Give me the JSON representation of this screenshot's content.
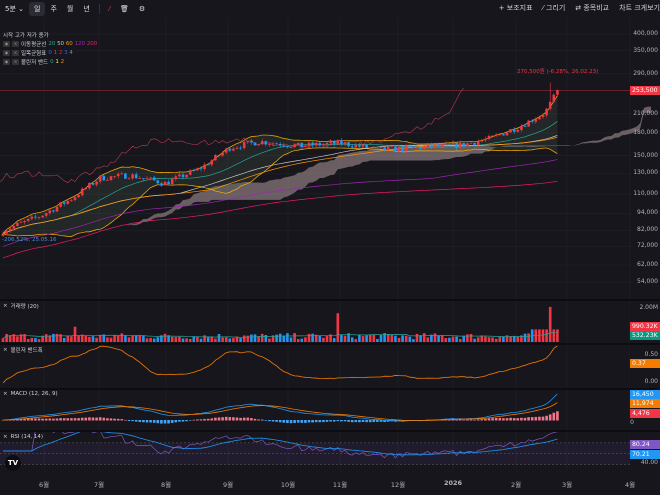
{
  "toolbar": {
    "interval": "5분",
    "periods": [
      "일",
      "주",
      "월",
      "년"
    ],
    "active_period": "일",
    "right": [
      "+ 보조지표",
      "⁄ 그리기",
      "⇄ 종목비교",
      "차트 크게보기"
    ]
  },
  "legend": {
    "ohlc_label": "시작 고가 저가 종가",
    "ma": {
      "name": "이동평균선",
      "periods": [
        "20",
        "50",
        "60",
        "120",
        "200"
      ],
      "colors": [
        "#26a69a",
        "#c8c8c8",
        "#ff9800",
        "#9c27b0",
        "#e91e63"
      ]
    },
    "ichimoku": {
      "name": "일목균형표",
      "params": [
        "0",
        "1",
        "2",
        "3",
        "4"
      ],
      "colors": [
        "#2962ff",
        "#f23645",
        "#e91e63",
        "#2962ff",
        "#888888"
      ]
    },
    "bollinger": {
      "name": "볼린저 밴드",
      "params": [
        "0",
        "1",
        "2"
      ],
      "colors": [
        "#26a69a",
        "#ffeb3b",
        "#ff9800"
      ]
    }
  },
  "price_axis": [
    "400,000",
    "350,000",
    "290,000",
    "210,000",
    "180,000",
    "150,000",
    "130,000",
    "110,000",
    "94,000",
    "82,000",
    "72,000",
    "62,000",
    "54,000"
  ],
  "last_price": "253,500",
  "annotations": {
    "high": "270,500원 (-6.28%, 26.02.23)",
    "low": "-206.52%, 25.05.16"
  },
  "panels": {
    "volume": {
      "title": "거래량 (20)",
      "axis": "2.00M",
      "value": "990.32K",
      "ma_value": "532.23K"
    },
    "bbw": {
      "title": "볼린저 밴드폭",
      "axis_top": "0.50",
      "axis_bottom": "0.00",
      "value": "0.37"
    },
    "macd": {
      "title": "MACD (12, 26, 9)",
      "macd": "16,450",
      "signal": "11,974",
      "hist": "4,476",
      "zero": "0"
    },
    "rsi": {
      "title": "RSI (14, 14)",
      "rsi": "80.24",
      "signal": "70.21",
      "level": "40.00"
    }
  },
  "time_axis": [
    "6월",
    "7월",
    "8월",
    "9월",
    "10월",
    "11월",
    "12월",
    "2026",
    "2월",
    "3월",
    "4월"
  ],
  "colors": {
    "up": "#f23645",
    "down": "#2196f3",
    "background": "#16161c"
  },
  "chart_data": {
    "type": "candlestick",
    "scale": "log",
    "ylim": [
      50000,
      420000
    ],
    "key_closes": [
      [
        "2025-05",
        82000
      ],
      [
        "2025-06",
        105000
      ],
      [
        "2025-07",
        125000
      ],
      [
        "2025-08",
        122000
      ],
      [
        "2025-09",
        160000
      ],
      [
        "2025-10",
        162000
      ],
      [
        "2025-11",
        165000
      ],
      [
        "2025-12",
        158000
      ],
      [
        "2026-01",
        163000
      ],
      [
        "2026-02",
        210000
      ],
      [
        "2026-02-26",
        253500
      ]
    ]
  }
}
